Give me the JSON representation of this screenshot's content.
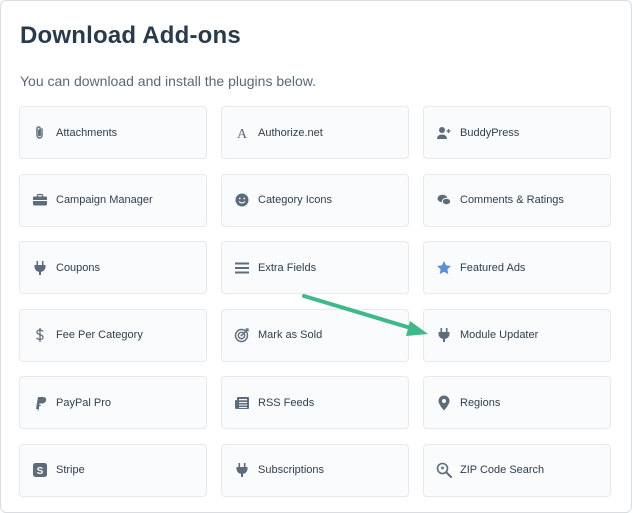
{
  "header": {
    "title": "Download Add-ons",
    "subtitle": "You can download and install the plugins below."
  },
  "addons": [
    {
      "label": "Attachments",
      "icon": "paperclip-icon"
    },
    {
      "label": "Authorize.net",
      "icon": "font-a-icon"
    },
    {
      "label": "BuddyPress",
      "icon": "user-plus-icon"
    },
    {
      "label": "Campaign Manager",
      "icon": "briefcase-icon"
    },
    {
      "label": "Category Icons",
      "icon": "smiley-icon"
    },
    {
      "label": "Comments & Ratings",
      "icon": "comments-icon"
    },
    {
      "label": "Coupons",
      "icon": "plug-icon"
    },
    {
      "label": "Extra Fields",
      "icon": "bars-icon"
    },
    {
      "label": "Featured Ads",
      "icon": "star-icon"
    },
    {
      "label": "Fee Per Category",
      "icon": "dollar-icon"
    },
    {
      "label": "Mark as Sold",
      "icon": "bullseye-icon"
    },
    {
      "label": "Module Updater",
      "icon": "plug-icon"
    },
    {
      "label": "PayPal Pro",
      "icon": "paypal-icon"
    },
    {
      "label": "RSS Feeds",
      "icon": "newspaper-icon"
    },
    {
      "label": "Regions",
      "icon": "map-pin-icon"
    },
    {
      "label": "Stripe",
      "icon": "stripe-icon"
    },
    {
      "label": "Subscriptions",
      "icon": "plug-icon"
    },
    {
      "label": "ZIP Code Search",
      "icon": "search-location-icon"
    }
  ],
  "colors": {
    "icon": "#5d6b7a",
    "star": "#5b8fd6",
    "arrow": "#3fb88a"
  }
}
